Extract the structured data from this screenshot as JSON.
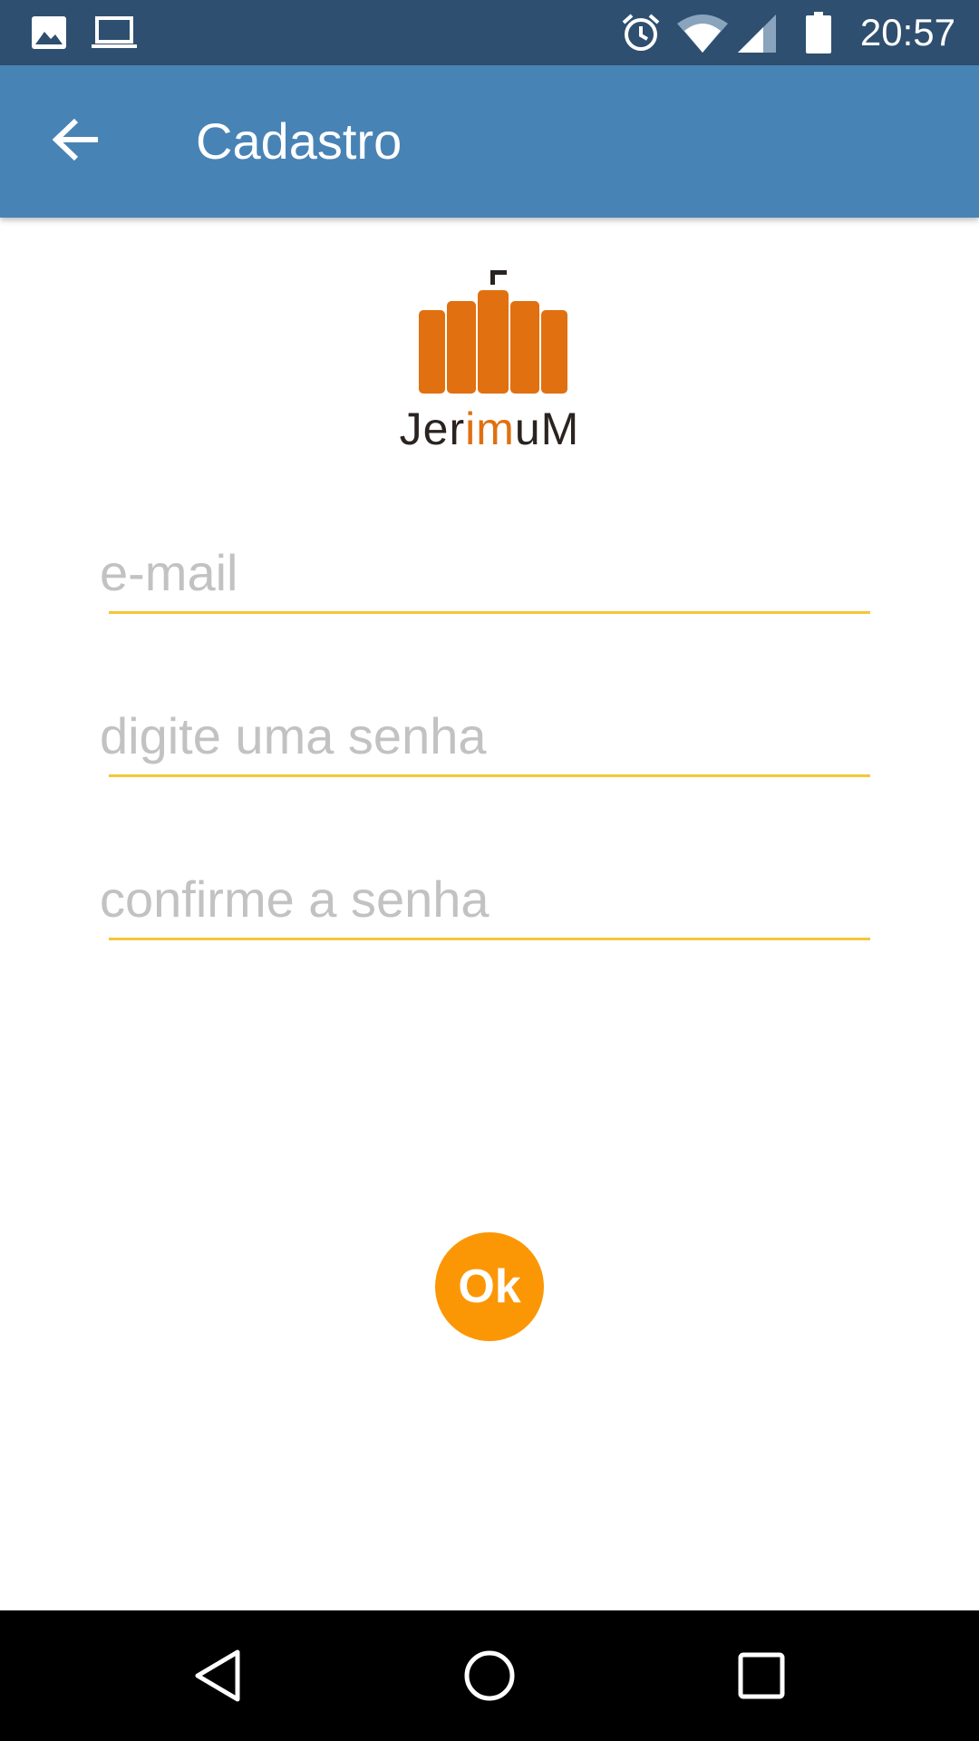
{
  "status_bar": {
    "time": "20:57",
    "left_icons": [
      "image-icon",
      "laptop-icon"
    ],
    "right_icons": [
      "alarm-icon",
      "wifi-icon",
      "signal-icon",
      "battery-icon"
    ]
  },
  "app_bar": {
    "title": "Cadastro",
    "back_icon": "arrow-left-icon",
    "color": "#4883b6"
  },
  "logo": {
    "text_prefix": "Jer",
    "text_highlight": "im",
    "text_suffix": "uM",
    "color": "#e07010"
  },
  "form": {
    "email_placeholder": "e-mail",
    "email_value": "",
    "password_placeholder": "digite uma senha",
    "password_value": "",
    "confirm_placeholder": "confirme a senha",
    "confirm_value": "",
    "underline_color": "#f6c638"
  },
  "ok_button": {
    "label": "Ok",
    "color": "#fb9705"
  },
  "nav_bar": {
    "icons": [
      "back-triangle-icon",
      "home-circle-icon",
      "recents-square-icon"
    ]
  }
}
